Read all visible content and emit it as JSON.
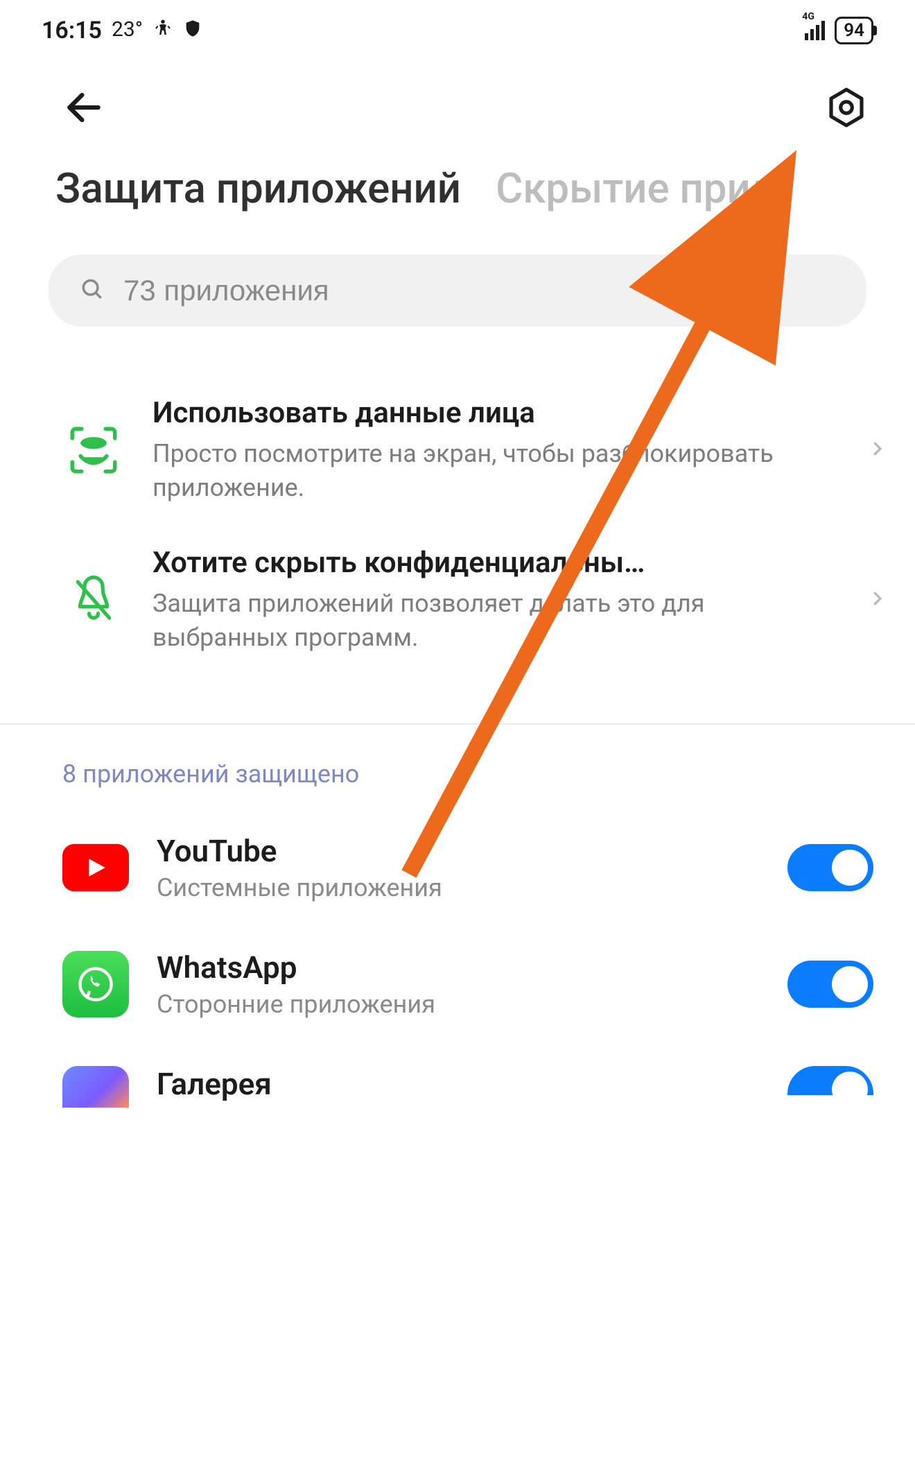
{
  "status": {
    "time": "16:15",
    "temp": "23°",
    "net_label": "4G",
    "battery": "94"
  },
  "tabs": {
    "active": "Защита приложений",
    "inactive": "Скрытие прил"
  },
  "search": {
    "placeholder": "73 приложения"
  },
  "features": [
    {
      "title": "Использовать данные лица",
      "desc": "Просто посмотрите на экран, чтобы разблокировать приложение."
    },
    {
      "title": "Хотите скрыть конфиденциальны…",
      "desc": "Защита приложений позволяет делать это для выбранных программ."
    }
  ],
  "section_label": "8 приложений защищено",
  "apps": [
    {
      "name": "YouTube",
      "category": "Системные приложения",
      "enabled": true
    },
    {
      "name": "WhatsApp",
      "category": "Сторонние приложения",
      "enabled": true
    },
    {
      "name": "Галерея",
      "category": "",
      "enabled": true
    }
  ]
}
